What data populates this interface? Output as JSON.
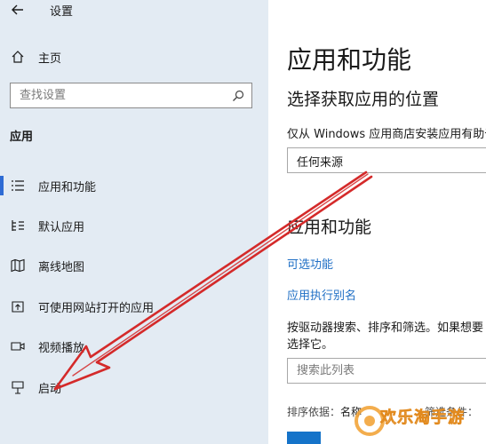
{
  "window": {
    "title": "设置"
  },
  "sidebar": {
    "home": "主页",
    "search_placeholder": "查找设置",
    "section": "应用",
    "items": [
      {
        "label": "应用和功能",
        "icon": "list-icon",
        "active": true
      },
      {
        "label": "默认应用",
        "icon": "default-apps-icon",
        "active": false
      },
      {
        "label": "离线地图",
        "icon": "map-icon",
        "active": false
      },
      {
        "label": "可使用网站打开的应用",
        "icon": "open-external-icon",
        "active": false
      },
      {
        "label": "视频播放",
        "icon": "video-icon",
        "active": false
      },
      {
        "label": "启动",
        "icon": "startup-icon",
        "active": false
      }
    ]
  },
  "main": {
    "title": "应用和功能",
    "source_heading": "选择获取应用的位置",
    "source_desc": "仅从 Windows 应用商店安装应用有助于",
    "source_value": "任何来源",
    "apps_heading": "应用和功能",
    "optional_link": "可选功能",
    "alias_link": "应用执行别名",
    "desc_line1": "按驱动器搜索、排序和筛选。如果想要",
    "desc_line2": "选择它。",
    "search_placeholder": "搜索此列表",
    "sort_label": "排序依据：",
    "sort_value": "名称",
    "filter_label": "筛选条件："
  },
  "watermark": {
    "text": "欢乐淘手游"
  },
  "colors": {
    "accent": "#2e6bd4",
    "link": "#1f6fc5",
    "arrow": "#d42a2a",
    "sidebar_bg": "#e3ebf3"
  }
}
